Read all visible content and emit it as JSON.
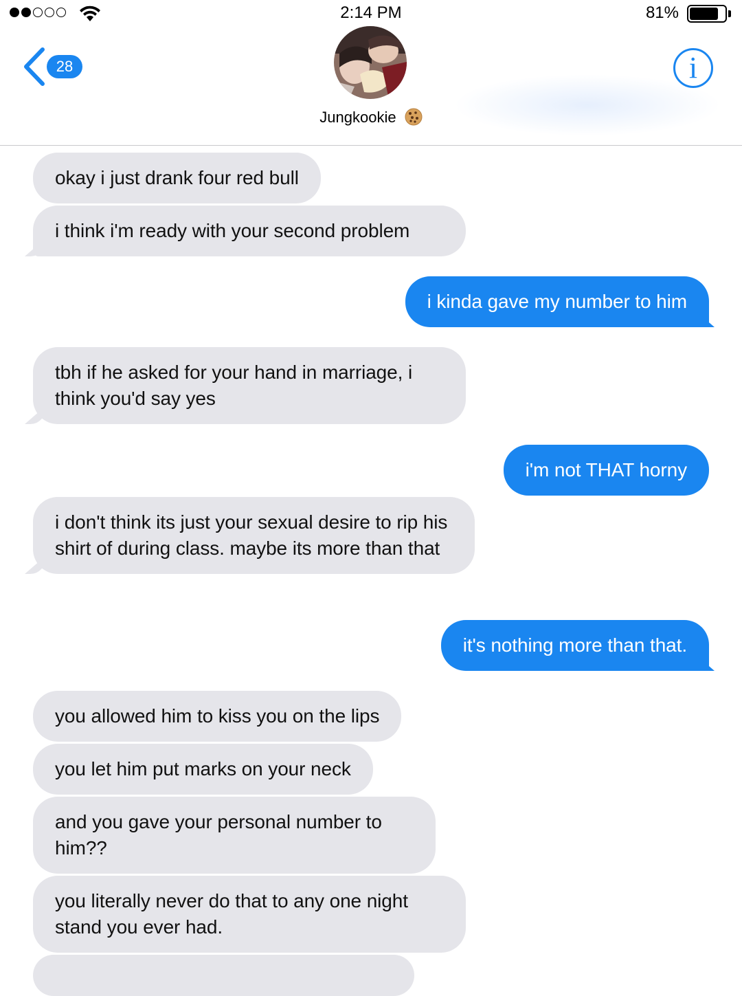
{
  "status_bar": {
    "time": "2:14 PM",
    "battery_percent": "81%",
    "battery_level": 0.81,
    "signal_bars_filled": 2,
    "signal_bars_total": 5
  },
  "header": {
    "back_badge": "28",
    "contact_name": "Jungkookie",
    "accent_color": "#1a86f0"
  },
  "messages": [
    {
      "direction": "in",
      "text": "okay i just drank four red bull"
    },
    {
      "direction": "in",
      "text": "i think i'm ready with your second problem"
    },
    {
      "direction": "out",
      "text": "i kinda gave my number to him"
    },
    {
      "direction": "in",
      "text": "tbh if he asked for your hand in marriage, i think you'd say yes"
    },
    {
      "direction": "out",
      "text": "i'm not THAT horny"
    },
    {
      "direction": "in",
      "text": "i don't think its just your sexual desire to rip his shirt of during class. maybe its more than that"
    },
    {
      "direction": "out",
      "text": "it's nothing more than that."
    },
    {
      "direction": "in",
      "text": "you allowed him to kiss you on the lips"
    },
    {
      "direction": "in",
      "text": "you let him put marks on your neck"
    },
    {
      "direction": "in",
      "text": "and you gave your personal number to him??"
    },
    {
      "direction": "in",
      "text": "you literally never do that to any one night stand you ever had."
    }
  ],
  "colors": {
    "incoming_bubble": "#e5e5ea",
    "outgoing_bubble": "#1a86f0"
  }
}
